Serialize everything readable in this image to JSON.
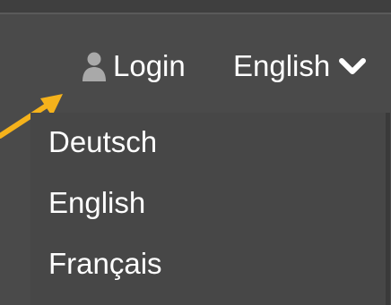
{
  "navbar": {
    "login_label": "Login",
    "user_icon": "user-icon",
    "language_selected": "English",
    "chevron_icon": "chevron-down-icon"
  },
  "language_menu": {
    "items": [
      {
        "label": "Deutsch"
      },
      {
        "label": "English"
      },
      {
        "label": "Français"
      }
    ]
  },
  "annotation": {
    "arrow_color": "#f5b21b"
  },
  "colors": {
    "background": "#4a4a4a",
    "text": "#ffffff",
    "icon_muted": "#a9a9a9"
  }
}
